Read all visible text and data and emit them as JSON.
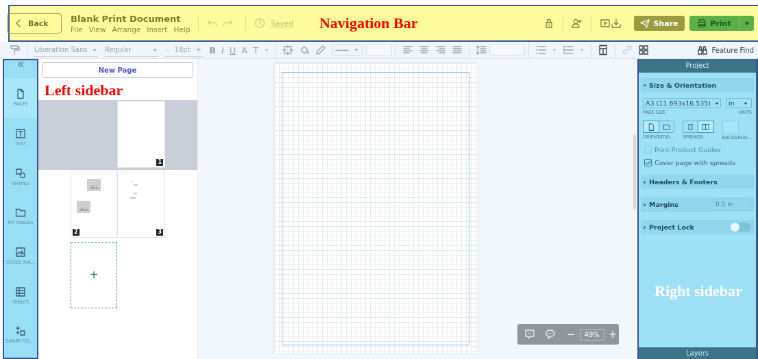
{
  "nav": {
    "back": "Back",
    "title": "Blank Print Document",
    "menu": [
      "File",
      "View",
      "Arrange",
      "Insert",
      "Help"
    ],
    "saved": "Saved",
    "share": "Share",
    "print": "Print"
  },
  "toolbar": {
    "font": "Liberation Sans",
    "weight": "Regular",
    "minus": "-",
    "size": "18pt",
    "plus": "+",
    "styles": [
      "B",
      "I",
      "U",
      "A",
      "T"
    ],
    "feature_find": "Feature Find"
  },
  "left_rail": {
    "items": [
      {
        "label": "PAGES",
        "selected": true
      },
      {
        "label": "TEXT",
        "selected": false
      },
      {
        "label": "SHAPES",
        "selected": false
      },
      {
        "label": "MY IMAGES",
        "selected": false
      },
      {
        "label": "STOCK IMA...",
        "selected": false
      },
      {
        "label": "TABLES",
        "selected": false
      },
      {
        "label": "SMART FIEL...",
        "selected": false
      }
    ]
  },
  "pages_panel": {
    "new_page": "New Page",
    "pages": [
      {
        "number": "1",
        "kind": "blank",
        "selected": true
      },
      {
        "number": "2",
        "kind": "images",
        "selected": false
      },
      {
        "number": "3",
        "kind": "lines",
        "selected": false
      }
    ],
    "add": "+"
  },
  "zoom": {
    "minus": "−",
    "value": "49%",
    "plus": "+"
  },
  "right_sidebar": {
    "title": "Project",
    "size_section": {
      "title": "Size & Orientation",
      "expanded": true,
      "page_size": "A3 (11.693x16.535)",
      "page_size_label": "PAGE SIZE",
      "units": "in",
      "units_label": "UNITS",
      "orientation_label": "ORIENTATIO...",
      "spreads_label": "SPREADS",
      "background_label": "BACKGROU...",
      "orientations": [
        {
          "selected": true
        },
        {
          "selected": false
        }
      ],
      "spreads": [
        {
          "selected": false
        },
        {
          "selected": true
        }
      ],
      "options": [
        {
          "label": "Print Product Guides",
          "checked": false,
          "disabled": true
        },
        {
          "label": "Cover page with spreads",
          "checked": true,
          "disabled": false
        }
      ]
    },
    "sections": [
      {
        "kind": "plain",
        "title": "Headers & Footers",
        "expanded": false
      },
      {
        "kind": "value",
        "title": "Margins",
        "expanded": false,
        "value": "0.5 in"
      },
      {
        "kind": "toggle",
        "title": "Project Lock",
        "expanded": false,
        "on": false
      }
    ],
    "footer": "Layers"
  },
  "annotations": [
    {
      "text": "Navigation Bar",
      "color": "#ff0000"
    },
    {
      "text": "Left sidebar",
      "color": "#ff0000"
    },
    {
      "text": "Right sidebar",
      "color": "#ffffff"
    }
  ]
}
